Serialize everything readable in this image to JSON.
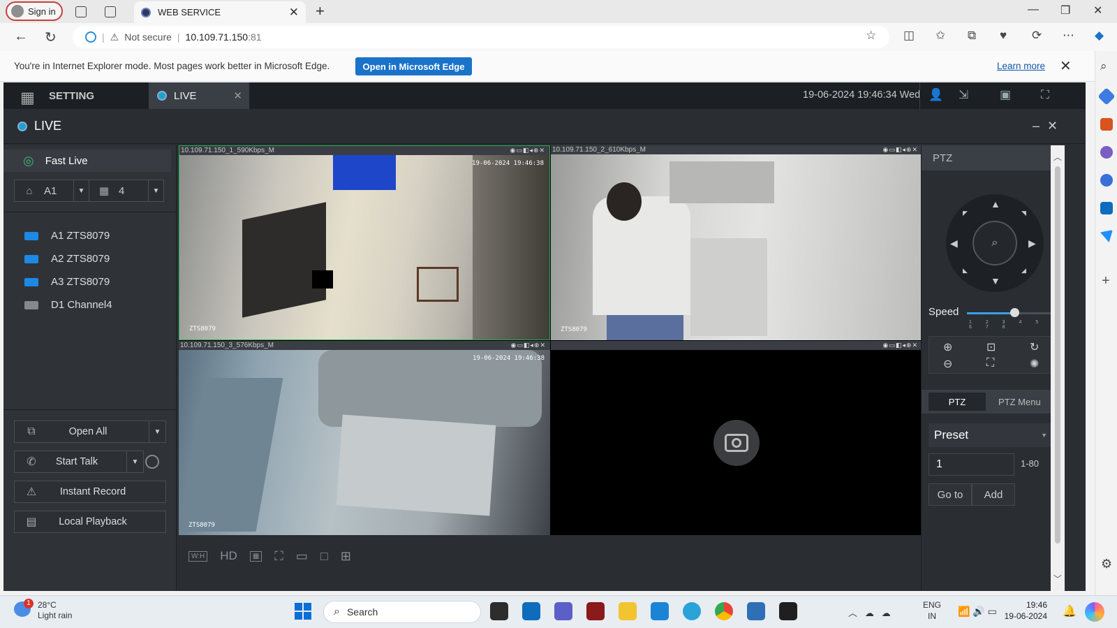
{
  "browser": {
    "signin_label": "Sign in",
    "tab_title": "WEB SERVICE",
    "url_security": "Not secure",
    "url_host": "10.109.71.150",
    "url_port": ":81",
    "ie_mode_message": "You're in Internet Explorer mode. Most pages work better in Microsoft Edge.",
    "open_edge_label": "Open in Microsoft Edge",
    "learn_more_label": "Learn more"
  },
  "app": {
    "setting_label": "SETTING",
    "live_tab_label": "LIVE",
    "datetime": "19-06-2024 19:46:34 Wed",
    "live_header": "LIVE"
  },
  "left_panel": {
    "fast_live_label": "Fast Live",
    "channel_select": "A1",
    "split_select": "4",
    "channels": [
      {
        "label": "A1 ZTS8079",
        "icon": "camera-icon-blue"
      },
      {
        "label": "A2 ZTS8079",
        "icon": "camera-icon-blue"
      },
      {
        "label": "A3 ZTS8079",
        "icon": "camera-icon-blue"
      },
      {
        "label": "D1 Channel4",
        "icon": "camera-icon-grey"
      }
    ],
    "buttons": {
      "open_all": "Open All",
      "start_talk": "Start Talk",
      "instant_record": "Instant Record",
      "local_playback": "Local Playback"
    }
  },
  "video": {
    "tiles": [
      {
        "header": "10.109.71.150_1_590Kbps_M",
        "timestamp": "19-06-2024 19:46:38",
        "cam_label": "ZTS8079"
      },
      {
        "header": "10.109.71.150_2_610Kbps_M",
        "timestamp": "",
        "cam_label": "ZTS8079"
      },
      {
        "header": "10.109.71.150_3_576Kbps_M",
        "timestamp": "19-06-2024 19:46:38",
        "cam_label": "ZTS8079"
      },
      {
        "header": "",
        "timestamp": "",
        "cam_label": ""
      }
    ],
    "toolbar": {
      "hd_label": "HD"
    }
  },
  "ptz": {
    "title": "PTZ",
    "speed_label": "Speed",
    "speed_value": 5,
    "speed_ticks": "1 2 3 4 5 6 7 8",
    "tab_ptz": "PTZ",
    "tab_menu": "PTZ Menu",
    "preset_label": "Preset",
    "preset_value": "1",
    "preset_range": "1-80",
    "goto_label": "Go to",
    "add_label": "Add"
  },
  "taskbar": {
    "temperature": "28°C",
    "weather": "Light rain",
    "weather_badge": "1",
    "search_label": "Search",
    "lang_top": "ENG",
    "lang_bottom": "IN",
    "time": "19:46",
    "date": "19-06-2024"
  },
  "colors": {
    "accent_blue": "#1a73c9",
    "live_green": "#3cb371",
    "selection_green": "#22b14c"
  }
}
